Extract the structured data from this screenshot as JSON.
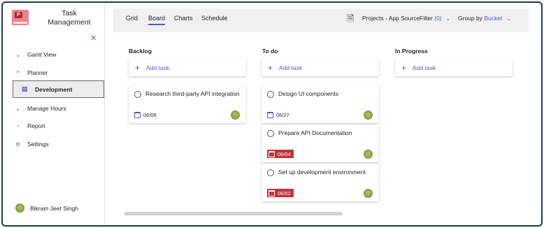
{
  "app": {
    "title": "Task Management",
    "logo_text": "P"
  },
  "sidebar": {
    "items": [
      {
        "label": "Gantt View",
        "icon": "chevron-down"
      },
      {
        "label": "Planner",
        "icon": "chevron-up"
      },
      {
        "label": "Development",
        "icon": "board-icon",
        "selected": true
      },
      {
        "label": "Manage Hours",
        "icon": "chevron-down"
      },
      {
        "label": "Report",
        "icon": "report-icon"
      },
      {
        "label": "Settings",
        "icon": "gear-icon"
      }
    ],
    "user": {
      "name": "Bikram Jeet Singh"
    }
  },
  "topbar": {
    "tabs": [
      "Grid",
      "Board",
      "Charts",
      "Schedule"
    ],
    "active_tab": "Board",
    "plan_label": "Projects - App Source",
    "filter_label": "Filter",
    "filter_count": "(0)",
    "group_label": "Group by",
    "group_value": "Bucket"
  },
  "board": {
    "add_task_label": "Add task",
    "columns": [
      {
        "name": "Backlog",
        "tasks": [
          {
            "title": "Research third-party API integration",
            "date": "06/06",
            "overdue": false
          }
        ]
      },
      {
        "name": "To do",
        "tasks": [
          {
            "title": "Design UI components",
            "date": "06/27",
            "overdue": false
          },
          {
            "title": "Prepare API Documentation",
            "date": "06/04",
            "overdue": true
          },
          {
            "title": "Set up development environment",
            "date": "06/02",
            "overdue": true
          }
        ]
      },
      {
        "name": "In Progress",
        "tasks": []
      }
    ]
  },
  "colors": {
    "accent": "#4b5fbf",
    "overdue": "#c4313b",
    "frame": "#1f3a4a"
  }
}
